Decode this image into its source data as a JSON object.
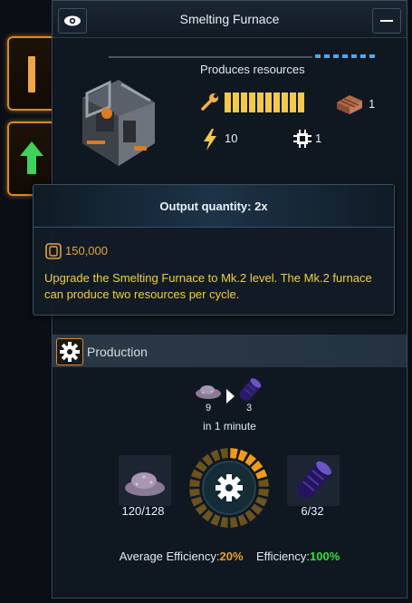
{
  "window": {
    "title": "Smelting Furnace",
    "eye_icon": "eye-icon",
    "minimize_icon": "minimize-icon"
  },
  "building": {
    "produces_label": "Produces resources",
    "level_segments_filled": 10,
    "level_segments_total": 10,
    "resource_count": "1",
    "power": "10",
    "chips": "1"
  },
  "tooltip": {
    "title": "Output quantity: 2x",
    "cost": "150,000",
    "description": "Upgrade the Smelting Furnace to Mk.2 level. The Mk.2 furnace can produce two resources per cycle."
  },
  "production": {
    "header": "Production",
    "recipe_in_qty": "9",
    "recipe_out_qty": "3",
    "cycle_time": "in 1 minute",
    "input_stock": "120/128",
    "output_stock": "6/32",
    "progress_fraction": 0.2
  },
  "efficiency": {
    "avg_label": "Average Efficiency:",
    "avg_value": "20%",
    "eff_label": "Efficiency:",
    "eff_value": "100%"
  },
  "colors": {
    "accent_orange": "#d98a28",
    "level_yellow": "#f4c84a",
    "desc_yellow": "#f0cf3a",
    "efficiency_green": "#33e03a"
  }
}
